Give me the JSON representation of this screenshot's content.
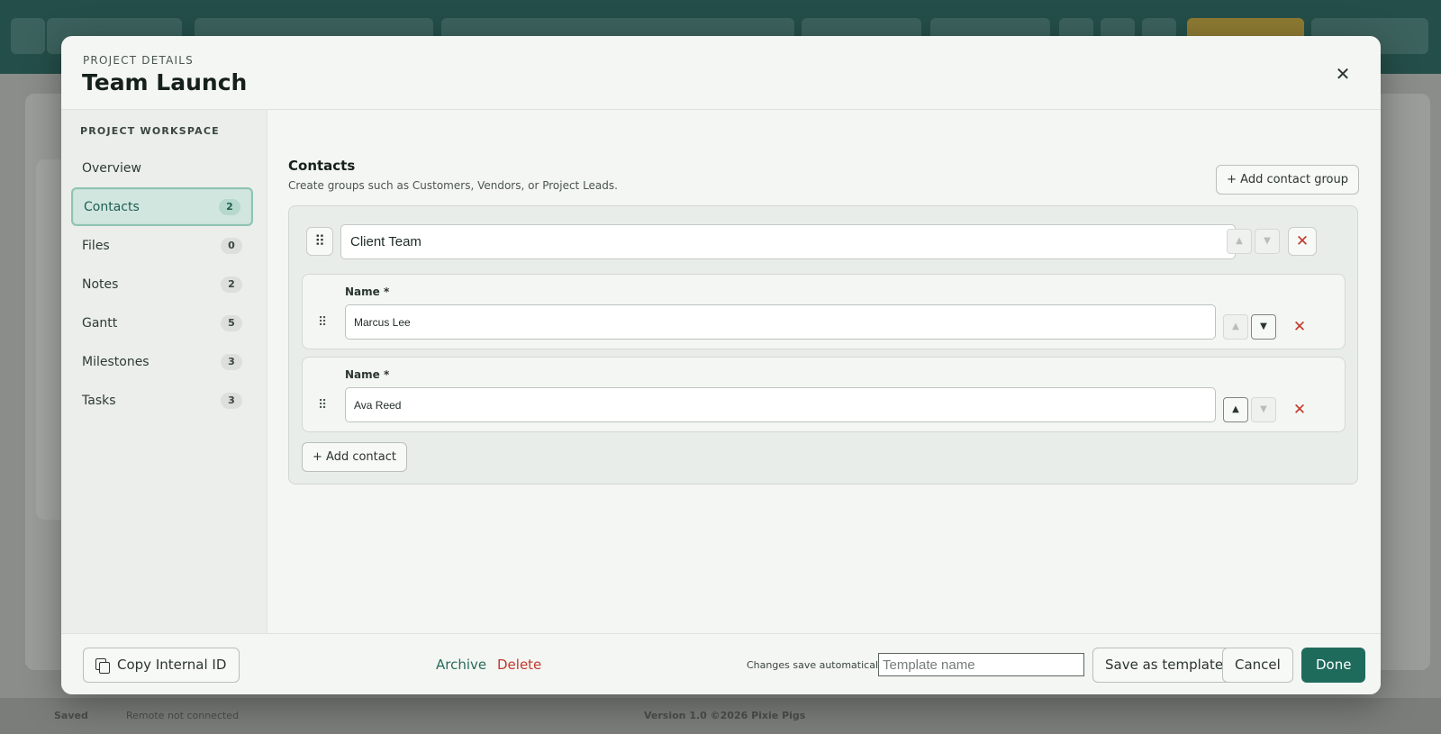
{
  "background": {
    "status_saved": "Saved",
    "status_remote": "Remote not connected",
    "status_version": "Version 1.0 ©2026 Pixie Pigs"
  },
  "modal": {
    "eyebrow": "PROJECT DETAILS",
    "title": "Team Launch",
    "close_glyph": "✕"
  },
  "sidebar": {
    "heading": "PROJECT WORKSPACE",
    "items": [
      {
        "label": "Overview",
        "count": ""
      },
      {
        "label": "Contacts",
        "count": "2"
      },
      {
        "label": "Files",
        "count": "0"
      },
      {
        "label": "Notes",
        "count": "2"
      },
      {
        "label": "Gantt",
        "count": "5"
      },
      {
        "label": "Milestones",
        "count": "3"
      },
      {
        "label": "Tasks",
        "count": "3"
      }
    ],
    "active_index": 1
  },
  "contacts": {
    "title": "Contacts",
    "description": "Create groups such as Customers, Vendors, or Project Leads.",
    "add_group_label": "+ Add contact group",
    "group": {
      "name": "Client Team",
      "contacts": [
        {
          "field_label": "Name *",
          "value": "Marcus Lee"
        },
        {
          "field_label": "Name *",
          "value": "Ava Reed"
        }
      ],
      "add_contact_label": "+ Add contact"
    }
  },
  "footer": {
    "copy_id_label": "Copy Internal ID",
    "archive_label": "Archive",
    "delete_label": "Delete",
    "autosave_text": "Changes save automatically",
    "template_placeholder": "Template name",
    "save_template_label": "Save as template",
    "cancel_label": "Cancel",
    "done_label": "Done"
  },
  "colors": {
    "accent": "#1e6b5c",
    "danger": "#c0392b",
    "active_nav_bg": "#d1e6df"
  }
}
